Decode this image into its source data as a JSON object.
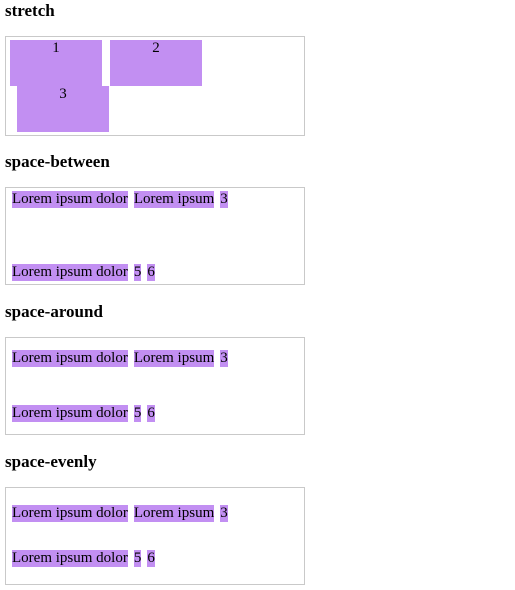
{
  "sections": [
    {
      "heading": "stretch",
      "items": [
        "1",
        "2",
        "3"
      ]
    },
    {
      "heading": "space-between",
      "items": [
        "Lorem ipsum dolor",
        "Lorem ipsum",
        "3",
        "Lorem ipsum dolor",
        "5",
        "6"
      ]
    },
    {
      "heading": "space-around",
      "items": [
        "Lorem ipsum dolor",
        "Lorem ipsum",
        "3",
        "Lorem ipsum dolor",
        "5",
        "6"
      ]
    },
    {
      "heading": "space-evenly",
      "items": [
        "Lorem ipsum dolor",
        "Lorem ipsum",
        "3",
        "Lorem ipsum dolor",
        "5",
        "6"
      ]
    }
  ],
  "colors": {
    "item_fill": "#c28ff2",
    "box_border": "#c9c9c9"
  }
}
